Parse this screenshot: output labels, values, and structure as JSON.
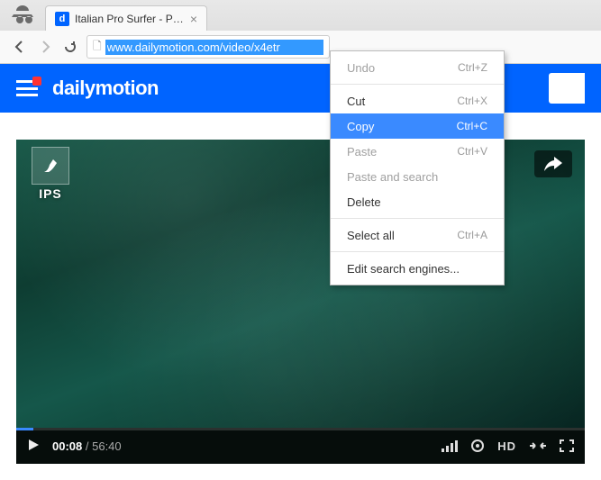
{
  "tab": {
    "title": "Italian Pro Surfer - Prima ",
    "favicon_letter": "d"
  },
  "omnibox": {
    "url": "www.dailymotion.com/video/x4etr"
  },
  "sitebar": {
    "brand": "dailymotion"
  },
  "video": {
    "logo": "IPS",
    "current_time": "00:08",
    "duration": "56:40",
    "quality": "HD"
  },
  "context_menu": {
    "items": [
      {
        "label": "Undo",
        "shortcut": "Ctrl+Z",
        "state": "disabled"
      },
      {
        "sep": true
      },
      {
        "label": "Cut",
        "shortcut": "Ctrl+X",
        "state": ""
      },
      {
        "label": "Copy",
        "shortcut": "Ctrl+C",
        "state": "highlight"
      },
      {
        "label": "Paste",
        "shortcut": "Ctrl+V",
        "state": "disabled"
      },
      {
        "label": "Paste and search",
        "shortcut": "",
        "state": "disabled"
      },
      {
        "label": "Delete",
        "shortcut": "",
        "state": ""
      },
      {
        "sep": true
      },
      {
        "label": "Select all",
        "shortcut": "Ctrl+A",
        "state": ""
      },
      {
        "sep": true
      },
      {
        "label": "Edit search engines...",
        "shortcut": "",
        "state": ""
      }
    ]
  }
}
